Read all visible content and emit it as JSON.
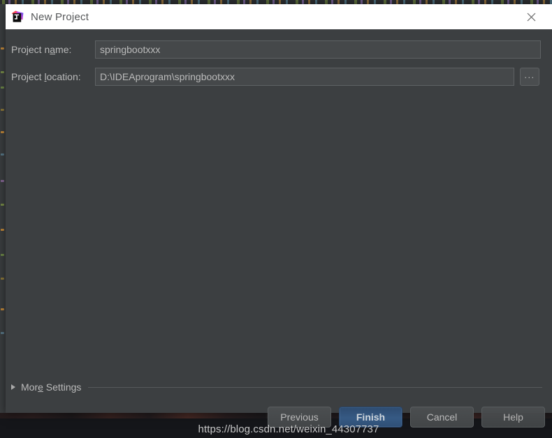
{
  "window": {
    "title": "New Project",
    "app_icon": "intellij-idea-icon",
    "close_icon": "close-icon"
  },
  "form": {
    "project_name": {
      "label_prefix": "Project n",
      "label_mnemonic": "a",
      "label_suffix": "me:",
      "value": "springbootxxx",
      "placeholder": ""
    },
    "project_location": {
      "label_prefix": "Project ",
      "label_mnemonic": "l",
      "label_suffix": "ocation:",
      "value": "D:\\IDEAprogram\\springbootxxx",
      "placeholder": "",
      "browse_label": "..."
    }
  },
  "more_settings": {
    "label_prefix": "Mor",
    "label_mnemonic": "e",
    "label_suffix": " Settings",
    "expanded": false,
    "toggle_icon": "chevron-right-icon"
  },
  "footer": {
    "buttons": [
      {
        "name": "previous",
        "label": "Previous",
        "primary": false
      },
      {
        "name": "finish",
        "label": "Finish",
        "primary": true
      },
      {
        "name": "cancel",
        "label": "Cancel",
        "primary": false
      },
      {
        "name": "help",
        "label": "Help",
        "primary": false
      }
    ]
  },
  "watermark": {
    "text": "https://blog.csdn.net/weixin_44307737"
  },
  "colors": {
    "dialog_background": "#3C3F41",
    "titlebar_background": "#FFFFFF",
    "title_text": "#555759",
    "label_text": "#BBBBBB",
    "input_background": "#45484A",
    "input_border": "#5E6264",
    "button_background": "#4B4E50",
    "primary_button_accent": "#365A84",
    "separator": "#565A5C"
  }
}
